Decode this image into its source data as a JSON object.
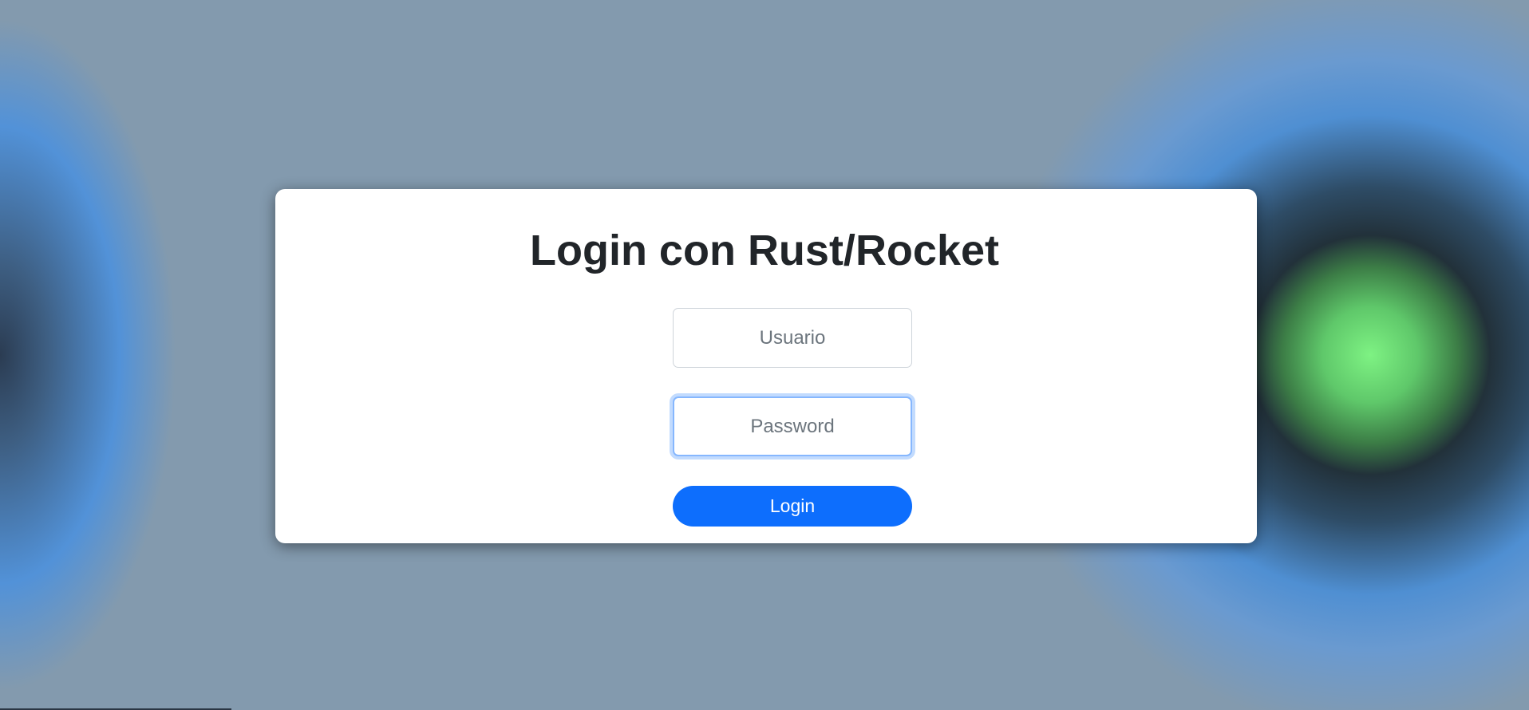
{
  "page": {
    "title": "Login con Rust/Rocket"
  },
  "form": {
    "username_placeholder": "Usuario",
    "username_value": "",
    "password_placeholder": "Password",
    "password_value": "",
    "login_label": "Login"
  },
  "colors": {
    "primary": "#0d6efd",
    "card": "#ffffff",
    "background": "#839aae",
    "glow": "#7ef283"
  }
}
